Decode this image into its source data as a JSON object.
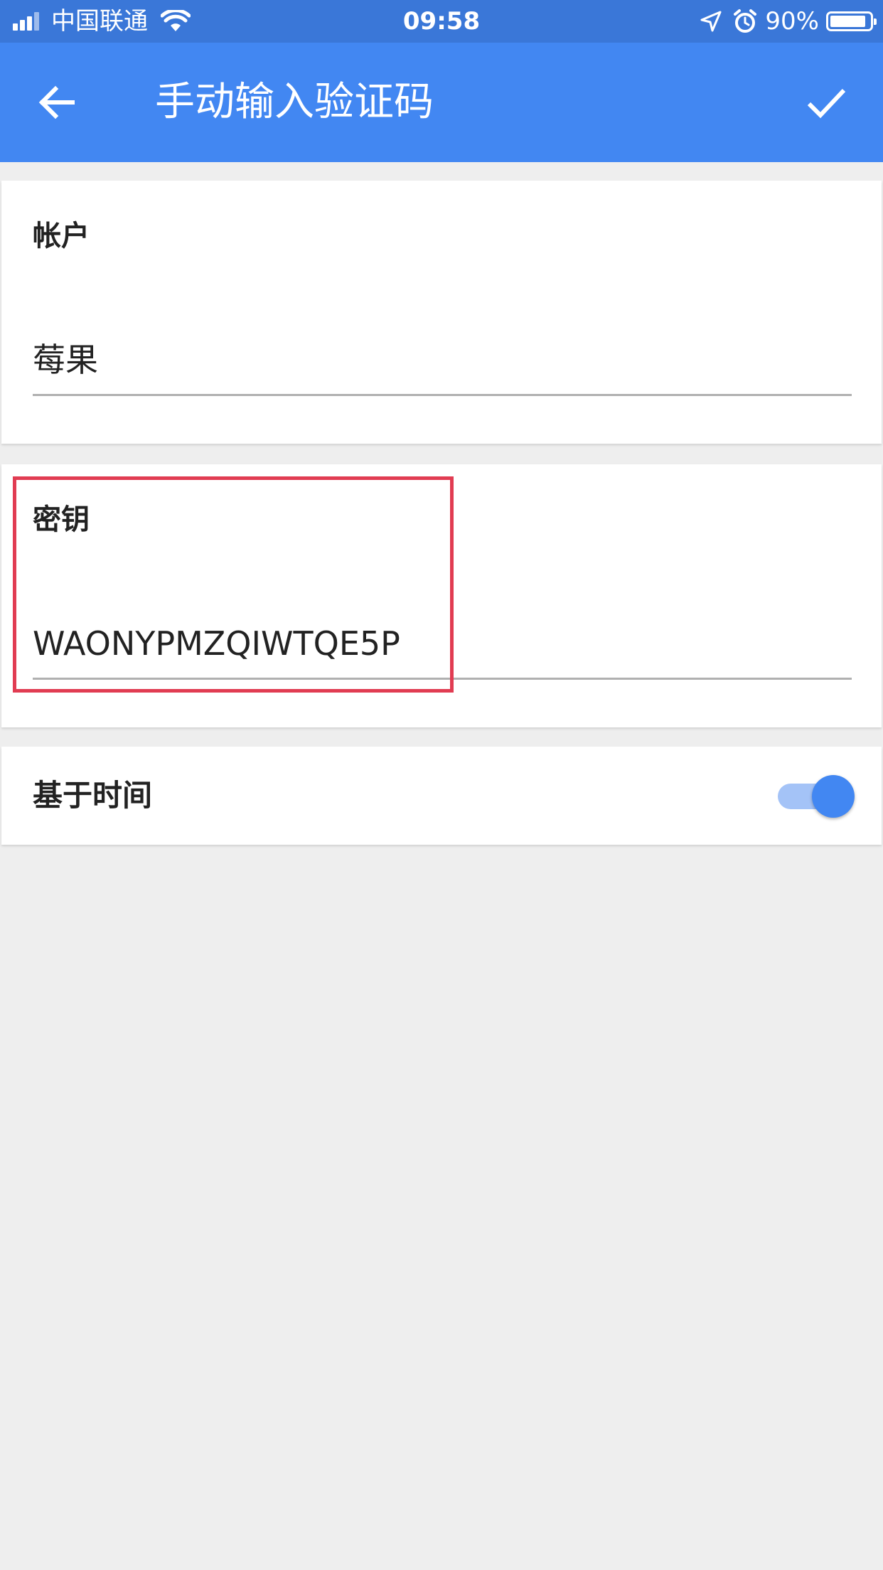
{
  "status_bar": {
    "carrier": "中国联通",
    "time": "09:58",
    "battery": "90%",
    "battery_level": 0.9
  },
  "app_bar": {
    "title": "手动输入验证码",
    "back_icon": "arrow-back-icon",
    "confirm_icon": "check-icon"
  },
  "account": {
    "label": "帐户",
    "value": "莓果"
  },
  "key": {
    "label": "密钥",
    "value": "WAONYPMZQIWTQE5P"
  },
  "time_based": {
    "label": "基于时间",
    "enabled": true
  },
  "colors": {
    "status_bar": "#3a77d8",
    "primary": "#4287f2",
    "highlight": "#e13c52",
    "background": "#eeeeee"
  }
}
